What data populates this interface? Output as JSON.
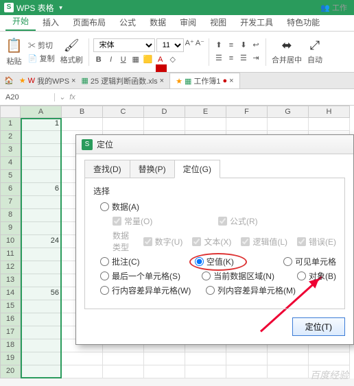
{
  "app": {
    "title": "WPS 表格",
    "logo": "S",
    "work": "工作"
  },
  "menu": {
    "items": [
      "开始",
      "插入",
      "页面布局",
      "公式",
      "数据",
      "审阅",
      "视图",
      "开发工具",
      "特色功能"
    ],
    "active": 0
  },
  "ribbon": {
    "paste": "粘贴",
    "cut": "剪切",
    "copy": "复制",
    "format_painter": "格式刷",
    "font_name": "宋体",
    "font_size": "11",
    "merge": "合并居中",
    "auto": "自动"
  },
  "doc_tabs": {
    "mywps": "我的WPS",
    "doc1": "25 逻辑判断函数.xls",
    "doc2": "工作簿1"
  },
  "name_box": "A20",
  "columns": [
    "A",
    "B",
    "C",
    "D",
    "E",
    "F",
    "G",
    "H"
  ],
  "cells": {
    "A1": "1",
    "A6": "6",
    "A10": "24",
    "A14": "56"
  },
  "row_count": 20,
  "dialog": {
    "title": "定位",
    "tabs": {
      "find": "查找(D)",
      "replace": "替换(P)",
      "goto": "定位(G)"
    },
    "select_label": "选择",
    "opts": {
      "data": "数据(A)",
      "const": "常量(O)",
      "formula": "公式(R)",
      "dtype": "数据类型",
      "number": "数字(U)",
      "text": "文本(X)",
      "logic": "逻辑值(L)",
      "error": "错误(E)",
      "comment": "批注(C)",
      "blank": "空值(K)",
      "visible": "可见单元格",
      "last": "最后一个单元格(S)",
      "region": "当前数据区域(N)",
      "object": "对象(B)",
      "rowdiff": "行内容差异单元格(W)",
      "coldiff": "列内容差异单元格(M)"
    },
    "button": "定位(T)"
  },
  "watermark": "百度经验"
}
